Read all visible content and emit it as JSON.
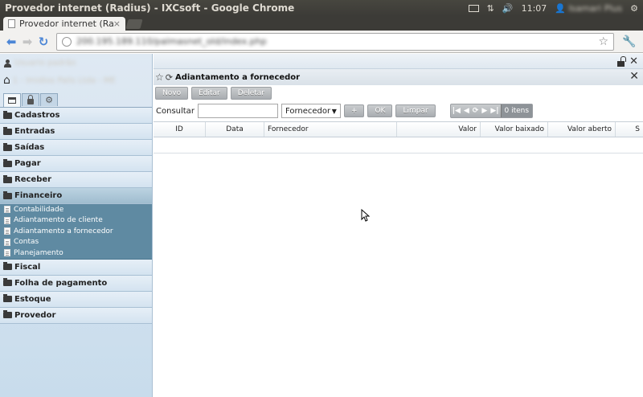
{
  "os_bar": {
    "window_title": "Provedor internet (Radius) - IXCsoft - Google Chrome",
    "clock": "11:07",
    "user_name": "Isamari Plus"
  },
  "browser": {
    "tab_title": "Provedor internet (Radius) - ",
    "tab_close": "×",
    "url": "200.195.189.110/palmasnet_old/index.php"
  },
  "sidebar": {
    "user": "Usuario padrão",
    "company": "1 - Imidios Palis Ltda - ME",
    "menu": [
      {
        "label": "Cadastros"
      },
      {
        "label": "Entradas"
      },
      {
        "label": "Saídas"
      },
      {
        "label": "Pagar"
      },
      {
        "label": "Receber"
      },
      {
        "label": "Financeiro"
      }
    ],
    "financeiro_submenu": [
      {
        "label": "Contabilidade"
      },
      {
        "label": "Adiantamento de cliente"
      },
      {
        "label": "Adiantamento a fornecedor"
      },
      {
        "label": "Contas"
      },
      {
        "label": "Planejamento"
      }
    ],
    "menu_after": [
      {
        "label": "Fiscal"
      },
      {
        "label": "Folha de pagamento"
      },
      {
        "label": "Estoque"
      },
      {
        "label": "Provedor"
      }
    ]
  },
  "window": {
    "title": "Adiantamento a fornecedor",
    "buttons": {
      "novo": "Novo",
      "editar": "Editar",
      "deletar": "Deletar"
    },
    "search": {
      "label": "Consultar",
      "value": "",
      "field": "Fornecedor",
      "plus": "+",
      "ok": "OK",
      "limpar": "Limpar",
      "count": "0 itens"
    },
    "grid_columns": [
      "ID",
      "Data",
      "Fornecedor",
      "Valor",
      "Valor baixado",
      "Valor aberto",
      "S"
    ]
  }
}
